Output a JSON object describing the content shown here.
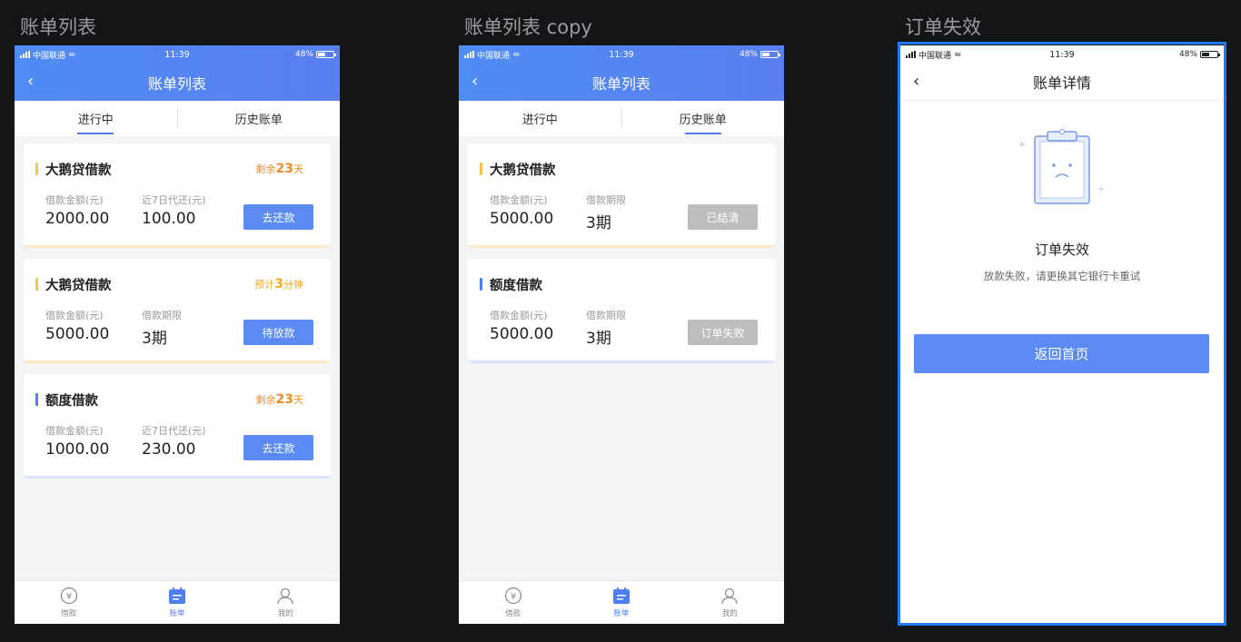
{
  "board_titles": [
    "账单列表",
    "账单列表 copy",
    "订单失效"
  ],
  "statusbar": {
    "carrier": "中国联通",
    "time": "11:39",
    "battery": "48%"
  },
  "screen1": {
    "nav_title": "账单列表",
    "tabs": [
      "进行中",
      "历史账单"
    ],
    "active_tab": 0,
    "cards": [
      {
        "title": "大鹅贷借款",
        "status_prefix": "剩余",
        "status_num": "23",
        "status_suffix": "天",
        "label1": "借款金额(元)",
        "value1": "2000.00",
        "label2": "近7日代还(元)",
        "value2": "100.00",
        "button": "去还款"
      },
      {
        "title": "大鹅贷借款",
        "status_prefix": "预计",
        "status_num": "3",
        "status_suffix": "分钟",
        "label1": "借款金额(元)",
        "value1": "5000.00",
        "label2": "借款期限",
        "value2": "3期",
        "button": "待放款"
      },
      {
        "title": "额度借款",
        "status_prefix": "剩余",
        "status_num": "23",
        "status_suffix": "天",
        "label1": "借款金额(元)",
        "value1": "1000.00",
        "label2": "近7日代还(元)",
        "value2": "230.00",
        "button": "去还款"
      }
    ]
  },
  "screen2": {
    "nav_title": "账单列表",
    "tabs": [
      "进行中",
      "历史账单"
    ],
    "active_tab": 1,
    "cards": [
      {
        "title": "大鹅贷借款",
        "label1": "借款金额(元)",
        "value1": "5000.00",
        "label2": "借款期限",
        "value2": "3期",
        "button": "已结清"
      },
      {
        "title": "额度借款",
        "label1": "借款金额(元)",
        "value1": "5000.00",
        "label2": "借款期限",
        "value2": "3期",
        "button": "订单失败"
      }
    ]
  },
  "screen3": {
    "nav_title": "账单详情",
    "result_title": "订单失效",
    "result_sub": "放款失败，请更换其它银行卡重试",
    "button": "返回首页"
  },
  "bottombar": {
    "items": [
      "借款",
      "账单",
      "我的"
    ],
    "active": 1
  },
  "colors": {
    "primary": "#5a8af2",
    "accent_orange": "#f5a623",
    "gray_button": "#bdbdbd",
    "selection": "#1e7bf5"
  },
  "icons": {
    "back": "chevron-left-icon",
    "loan": "yen-circle-icon",
    "bill": "calendar-icon",
    "me": "user-icon",
    "empty": "sad-clipboard-icon"
  }
}
